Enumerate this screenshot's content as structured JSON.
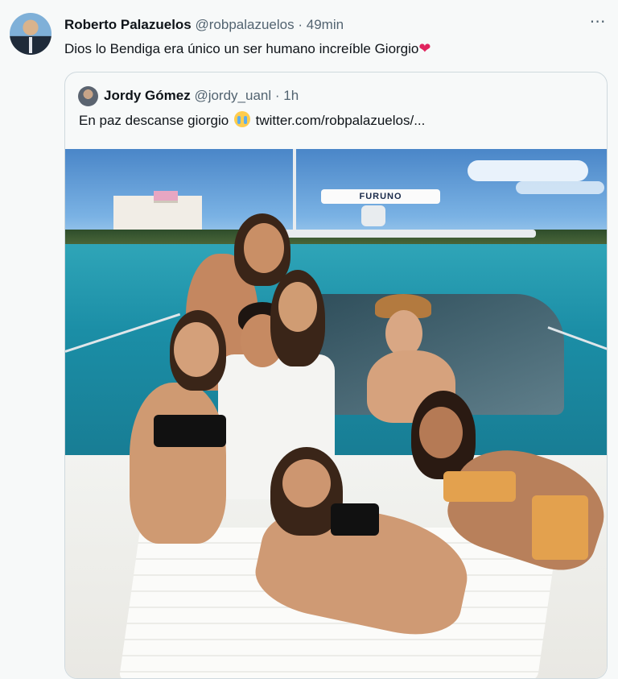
{
  "tweet": {
    "author_name": "Roberto Palazuelos",
    "author_handle": "@robpalazuelos",
    "separator": "·",
    "time": "49min",
    "more_icon": "⋯",
    "text": "Dios lo Bendiga era único  un ser humano increíble  Giorgio",
    "heart_emoji": "❤"
  },
  "quoted_tweet": {
    "author_name": "Jordy Gómez",
    "author_handle": "@jordy_uanl",
    "separator": "·",
    "time": "1h",
    "text": "En paz descanse giorgio",
    "link": "twitter.com/robpalazuelos/...",
    "photo": {
      "boat_brand_text": "FURUNO"
    }
  },
  "colors": {
    "background": "#f7f9f9",
    "text_primary": "#0f1419",
    "text_secondary": "#536471",
    "border": "#cfd9de",
    "heart": "#e0245e"
  },
  "icons": [
    "more-icon",
    "crying-face-emoji",
    "red-heart-emoji"
  ]
}
